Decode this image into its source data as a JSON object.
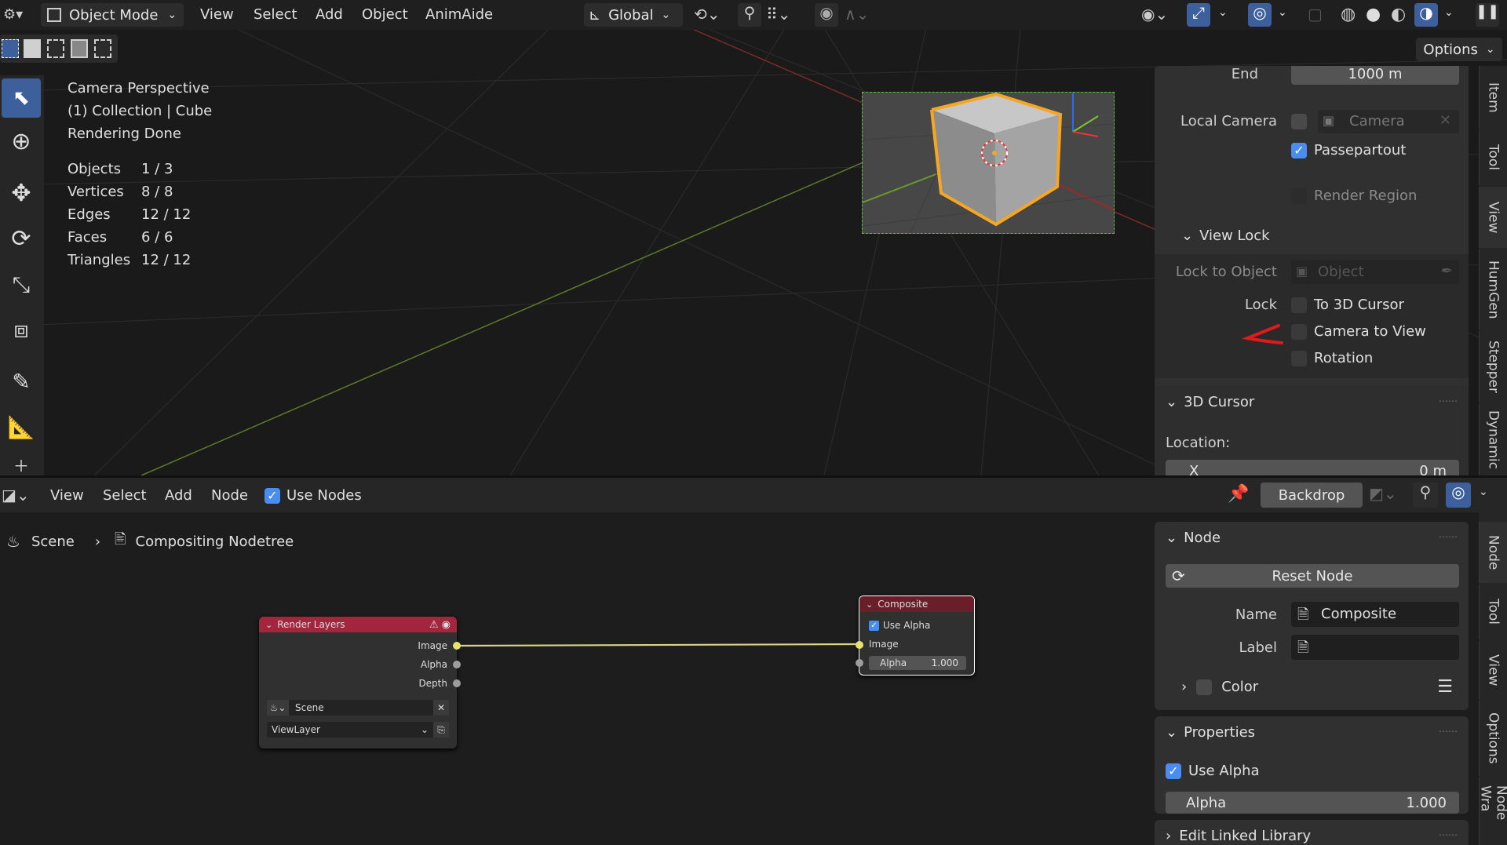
{
  "viewport": {
    "header": {
      "mode": "Object Mode",
      "menus": [
        "View",
        "Select",
        "Add",
        "Object",
        "AnimAide"
      ],
      "orientation": "Global",
      "options": "Options"
    },
    "info": {
      "lines": [
        "Camera Perspective",
        "(1) Collection | Cube",
        "Rendering Done"
      ],
      "stats": [
        {
          "label": "Objects",
          "value": "1 / 3"
        },
        {
          "label": "Vertices",
          "value": "8 / 8"
        },
        {
          "label": "Edges",
          "value": "12 / 12"
        },
        {
          "label": "Faces",
          "value": "6 / 6"
        },
        {
          "label": "Triangles",
          "value": "12 / 12"
        }
      ]
    },
    "sidebar": {
      "end_label": "End",
      "end_value": "1000 m",
      "local_camera_label": "Local Camera",
      "camera_placeholder": "Camera",
      "passepartout": "Passepartout",
      "render_region": "Render Region",
      "view_lock": "View Lock",
      "lock_to_object_label": "Lock to Object",
      "object_placeholder": "Object",
      "lock_label": "Lock",
      "to_3d_cursor": "To 3D Cursor",
      "camera_to_view": "Camera to View",
      "rotation": "Rotation",
      "cursor_panel": "3D Cursor",
      "location_label": "Location:",
      "x_label": "X",
      "x_value": "0 m",
      "tabs": [
        "Item",
        "Tool",
        "View",
        "HumGen",
        "Stepper",
        "Dynamic"
      ]
    }
  },
  "node_editor": {
    "header": {
      "menus": [
        "View",
        "Select",
        "Add",
        "Node"
      ],
      "use_nodes": "Use Nodes",
      "backdrop": "Backdrop"
    },
    "breadcrumb": {
      "scene": "Scene",
      "tree": "Compositing Nodetree"
    },
    "render_layers": {
      "title": "Render Layers",
      "outputs": [
        "Image",
        "Alpha",
        "Depth"
      ],
      "scene": "Scene",
      "view_layer": "ViewLayer"
    },
    "composite": {
      "title": "Composite",
      "use_alpha": "Use Alpha",
      "image": "Image",
      "alpha_label": "Alpha",
      "alpha_value": "1.000"
    },
    "sidebar": {
      "node_panel": "Node",
      "reset_node": "Reset Node",
      "name_label": "Name",
      "name_value": "Composite",
      "label_label": "Label",
      "label_value": "",
      "color": "Color",
      "properties_panel": "Properties",
      "use_alpha": "Use Alpha",
      "alpha_label": "Alpha",
      "alpha_value": "1.000",
      "linked_library": "Edit Linked Library",
      "tabs": [
        "Node",
        "Tool",
        "View",
        "Options",
        "Node Wra"
      ]
    }
  },
  "colors": {
    "accent": "#4a8df0",
    "selection": "#f5a623",
    "node_header_render": "#a3263f",
    "node_header_composite": "#6a1e2a",
    "annotation": "#e01a1a"
  }
}
